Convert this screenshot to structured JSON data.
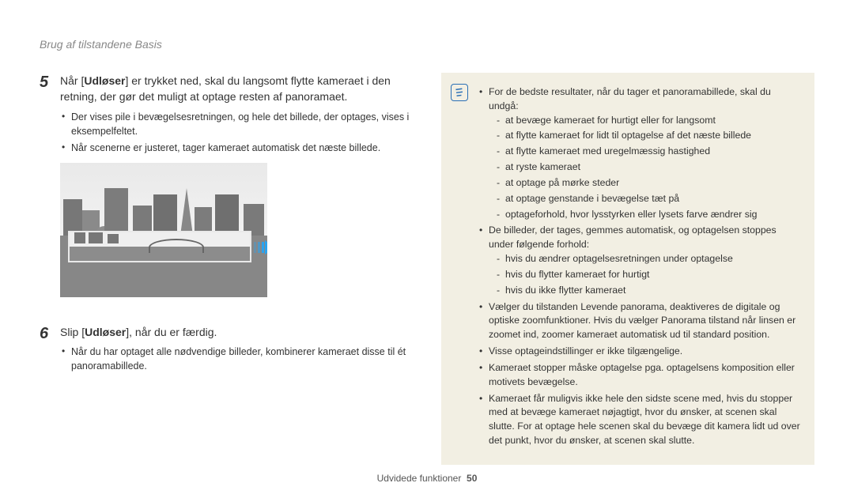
{
  "header": "Brug af tilstandene Basis",
  "steps": [
    {
      "number": "5",
      "main_pre": "Når [",
      "main_bold": "Udløser",
      "main_post": "] er trykket ned, skal du langsomt flytte kameraet i den retning, der gør det muligt at optage resten af panoramaet.",
      "bullets": [
        "Der vises pile i bevægelsesretningen, og hele det billede, der optages, vises i eksempelfeltet.",
        "Når scenerne er justeret, tager kameraet automatisk det næste billede."
      ]
    },
    {
      "number": "6",
      "main_pre": "Slip [",
      "main_bold": "Udløser",
      "main_post": "], når du er færdig.",
      "bullets": [
        "Når du har optaget alle nødvendige billeder, kombinerer kameraet disse til ét panoramabillede."
      ]
    }
  ],
  "note": {
    "bullets": [
      {
        "text": "For de bedste resultater, når du tager et panoramabillede, skal du undgå:",
        "dashes": [
          "at bevæge kameraet for hurtigt eller for langsomt",
          "at flytte kameraet for lidt til optagelse af det næste billede",
          "at flytte kameraet med uregelmæssig hastighed",
          "at ryste kameraet",
          "at optage på mørke steder",
          "at optage genstande i bevægelse tæt på",
          "optageforhold, hvor lysstyrken eller lysets farve ændrer sig"
        ]
      },
      {
        "text": "De billeder, der tages, gemmes automatisk, og optagelsen stoppes under følgende forhold:",
        "dashes": [
          "hvis du ændrer optagelsesretningen under optagelse",
          "hvis du flytter kameraet for hurtigt",
          "hvis du ikke flytter kameraet"
        ]
      },
      {
        "text": "Vælger du tilstanden Levende panorama, deaktiveres de digitale og optiske zoomfunktioner. Hvis du vælger Panorama tilstand når linsen er zoomet ind, zoomer kameraet automatisk ud til standard position."
      },
      {
        "text": "Visse optageindstillinger er ikke tilgængelige."
      },
      {
        "text": "Kameraet stopper måske optagelse pga. optagelsens komposition eller motivets bevægelse."
      },
      {
        "text": "Kameraet får muligvis ikke hele den sidste scene med, hvis du stopper med at bevæge kameraet nøjagtigt, hvor du ønsker, at scenen skal slutte. For at optage hele scenen skal du bevæge dit kamera lidt ud over det punkt, hvor du ønsker, at scenen skal slutte."
      }
    ]
  },
  "footer": {
    "label": "Udvidede funktioner",
    "page": "50"
  }
}
